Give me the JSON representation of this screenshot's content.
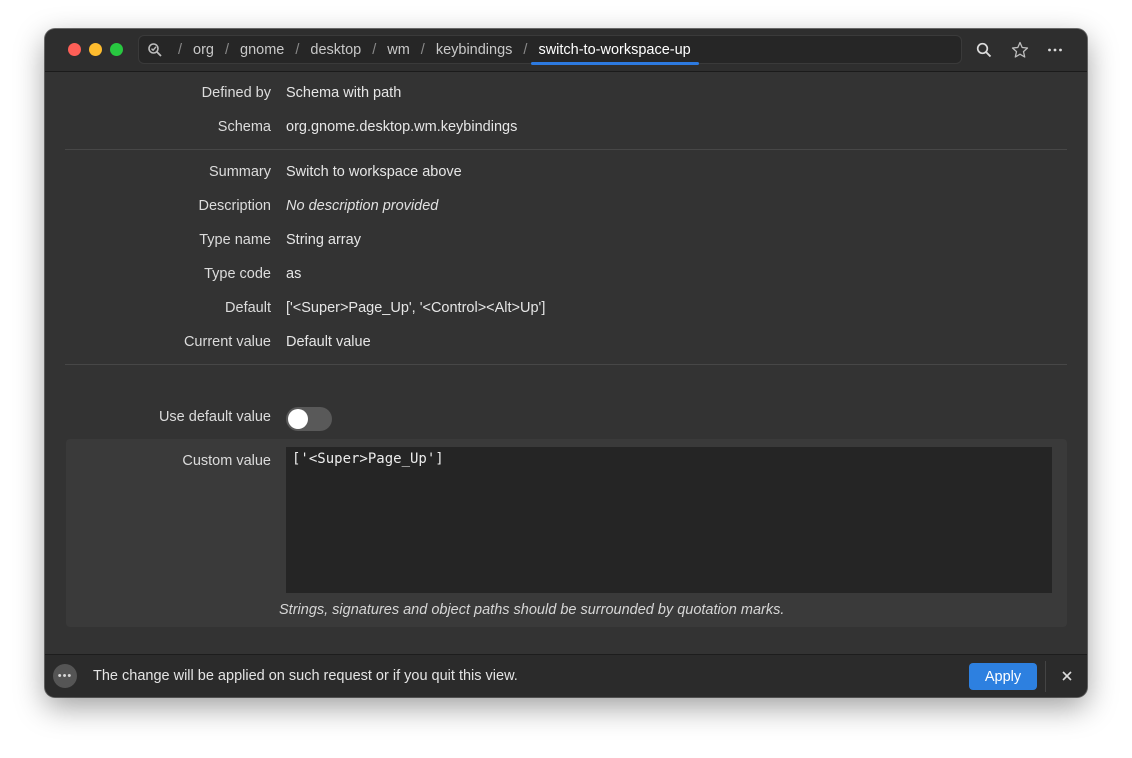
{
  "titlebar": {
    "breadcrumbs": [
      "org",
      "gnome",
      "desktop",
      "wm",
      "keybindings",
      "switch-to-workspace-up"
    ],
    "separator": "/",
    "icons": [
      "search-icon",
      "star-icon",
      "more-icon"
    ]
  },
  "details": {
    "defined_by": {
      "label": "Defined by",
      "value": "Schema with path"
    },
    "schema": {
      "label": "Schema",
      "value": "org.gnome.desktop.wm.keybindings"
    },
    "summary": {
      "label": "Summary",
      "value": "Switch to workspace above"
    },
    "description": {
      "label": "Description",
      "value": "No description provided"
    },
    "type_name": {
      "label": "Type name",
      "value": "String array"
    },
    "type_code": {
      "label": "Type code",
      "value": "as"
    },
    "default": {
      "label": "Default",
      "value": "['<Super>Page_Up', '<Control><Alt>Up']"
    },
    "current_value": {
      "label": "Current value",
      "value": "Default value"
    }
  },
  "use_default": {
    "label": "Use default value",
    "enabled": false
  },
  "custom": {
    "label": "Custom value",
    "value": "['<Super>Page_Up']",
    "hint": "Strings, signatures and object paths should be surrounded by quotation marks."
  },
  "bottombar": {
    "notice": "The change will be applied on such request or if you quit this view.",
    "apply_label": "Apply"
  },
  "colors": {
    "accent": "#2d80e0",
    "window_bg": "#333333",
    "close_red": "#fe5f57",
    "minimize_yellow": "#febc2e",
    "zoom_green": "#28c840"
  }
}
